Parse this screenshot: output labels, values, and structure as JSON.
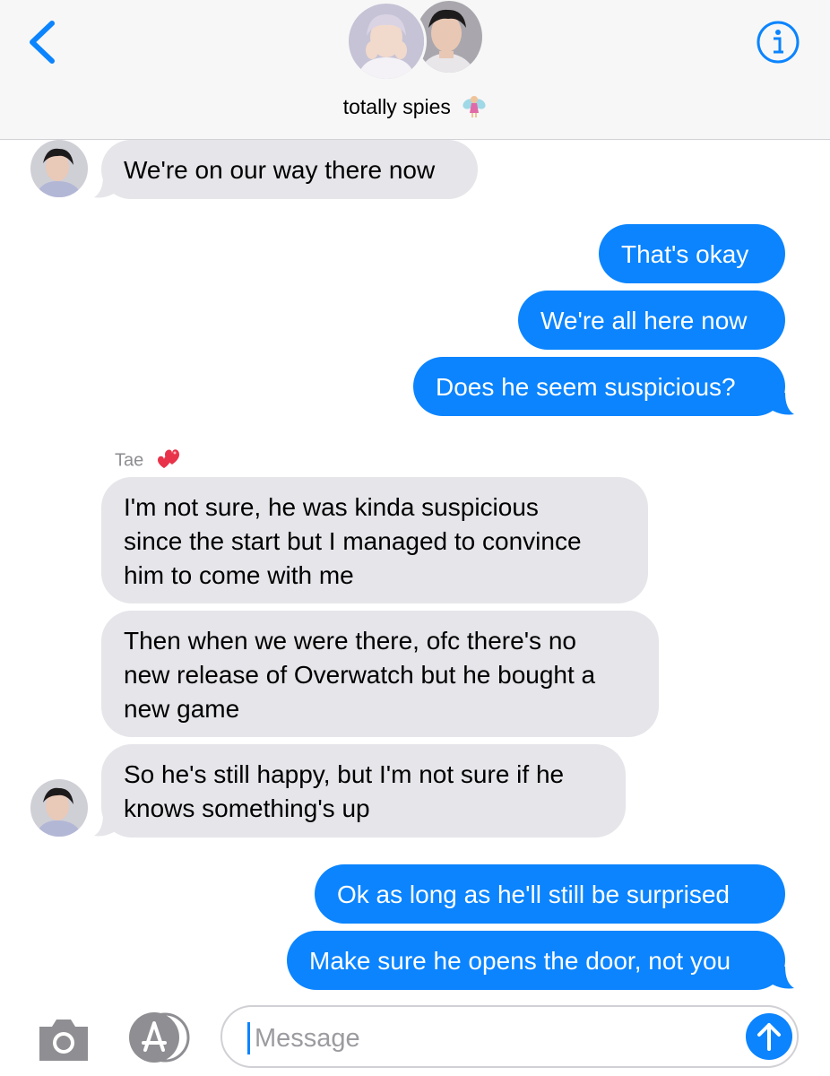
{
  "header": {
    "group_name": "totally spies",
    "back_icon": "chevron-left-icon",
    "info_icon": "info-icon",
    "accent_color": "#0b84fe"
  },
  "messages": [
    {
      "side": "incoming",
      "lines": [
        "We're on our way there now"
      ]
    },
    {
      "side": "outgoing",
      "lines": [
        "That's okay"
      ]
    },
    {
      "side": "outgoing",
      "lines": [
        "We're all here now"
      ]
    },
    {
      "side": "outgoing",
      "lines": [
        "Does he seem suspicious?"
      ]
    },
    {
      "side": "incoming",
      "sender": "Tae",
      "lines": [
        "I'm not sure, he was kinda suspicious",
        "since the start but I managed to convince",
        "him to come with me"
      ]
    },
    {
      "side": "incoming",
      "lines": [
        "Then when we were there, ofc there's no",
        "new release of Overwatch but he bought a",
        "new game"
      ]
    },
    {
      "side": "incoming",
      "lines": [
        "So he's still happy, but I'm not sure if he",
        "knows something's up"
      ]
    },
    {
      "side": "outgoing",
      "lines": [
        "Ok as long as he'll still be surprised"
      ]
    },
    {
      "side": "outgoing",
      "lines": [
        "Make sure he opens the door, not you"
      ]
    }
  ],
  "sender_label": "Tae",
  "input": {
    "placeholder": "Message",
    "camera_icon": "camera-icon",
    "apps_icon": "app-store-icon",
    "send_icon": "send-arrow-up-icon"
  }
}
